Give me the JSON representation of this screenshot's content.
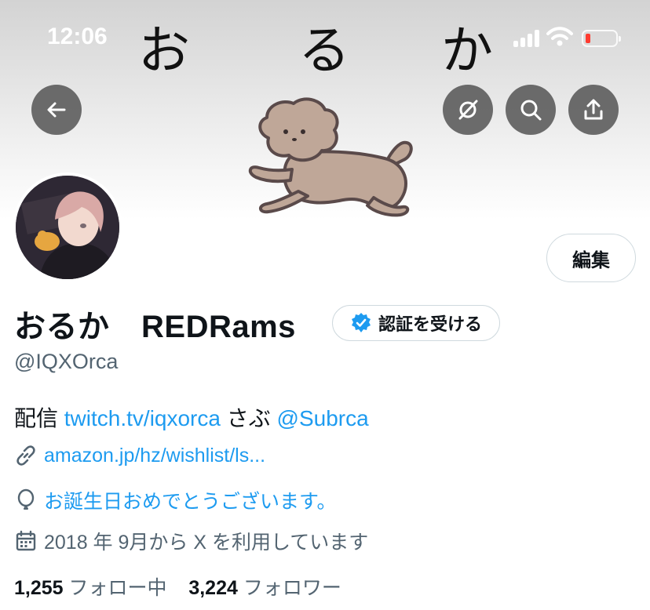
{
  "status_bar": {
    "time": "12:06"
  },
  "banner": {
    "chars": [
      "お",
      "る",
      "か"
    ]
  },
  "header_buttons": {
    "back": "back-arrow-icon",
    "hide": "eye-off-icon",
    "search": "search-icon",
    "share": "share-icon"
  },
  "profile": {
    "edit_label": "編集",
    "display_name": "おるか　REDRams",
    "verify_label": "認証を受ける",
    "handle": "@IQXOrca",
    "bio": {
      "prefix": "配信 ",
      "link1": "twitch.tv/iqxorca",
      "middle": " さぶ ",
      "mention": "@Subrca"
    },
    "website": "amazon.jp/hz/wishlist/ls...",
    "birthday": "お誕生日おめでとうございます。",
    "joined": "2018 年 9月から X を利用しています",
    "following_count": "1,255",
    "following_label": "フォロー中",
    "followers_count": "3,224",
    "followers_label": "フォロワー"
  },
  "colors": {
    "accent": "#1d9bf0",
    "secondary_text": "#536471",
    "battery_low": "#ff3b30"
  }
}
